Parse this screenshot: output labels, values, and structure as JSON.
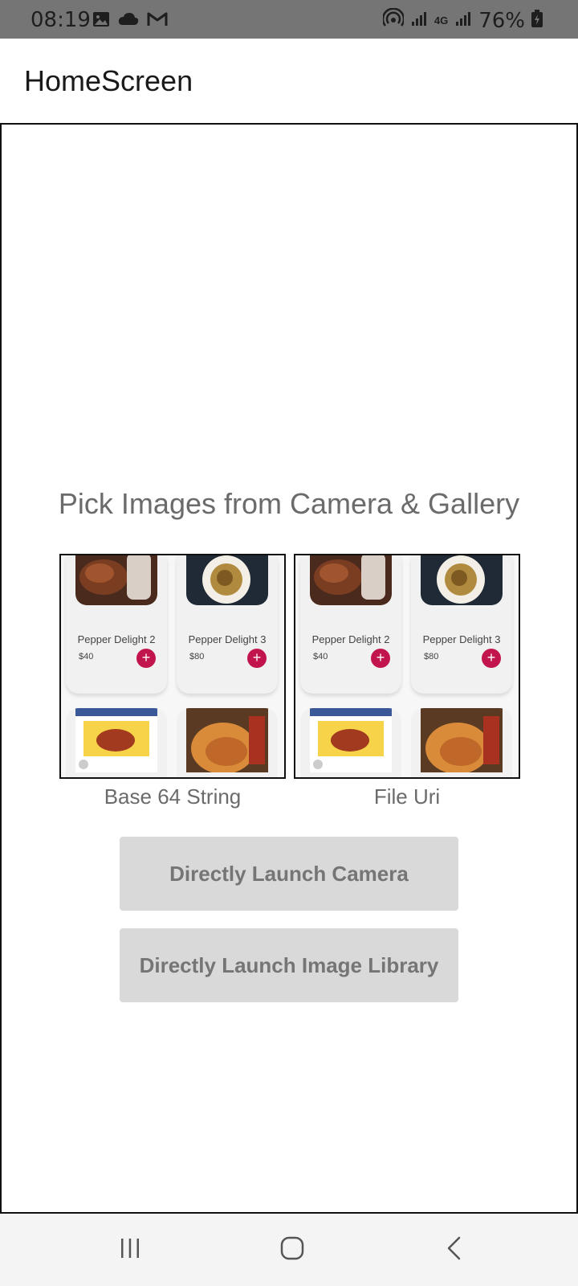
{
  "status_bar": {
    "time": "08:19",
    "left_icons": [
      "image-icon",
      "cloud-icon",
      "gmail-icon"
    ],
    "right_icons": [
      "hotspot-icon",
      "signal-icon",
      "4g-icon",
      "signal-icon"
    ],
    "network": "4G",
    "battery": "76%"
  },
  "app_bar": {
    "title": "HomeScreen"
  },
  "main": {
    "heading": "Pick Images from Camera & Gallery",
    "previews": [
      {
        "label": "Base 64 String",
        "cards": [
          {
            "name": "Pepper Delight 2",
            "price": "$40",
            "add": "+"
          },
          {
            "name": "Pepper Delight 3",
            "price": "$80",
            "add": "+"
          }
        ]
      },
      {
        "label": "File Uri",
        "cards": [
          {
            "name": "Pepper Delight 2",
            "price": "$40",
            "add": "+"
          },
          {
            "name": "Pepper Delight 3",
            "price": "$80",
            "add": "+"
          }
        ]
      }
    ],
    "buttons": {
      "camera": "Directly Launch Camera",
      "library": "Directly Launch Image Library"
    }
  },
  "colors": {
    "status_bar_bg": "#757575",
    "accent_add": "#c2144d",
    "button_bg": "#d9d9d9",
    "button_text": "#757575",
    "heading_text": "#6b6b6b"
  },
  "nav_bar": {
    "icons": [
      "recents-icon",
      "home-icon",
      "back-icon"
    ]
  }
}
